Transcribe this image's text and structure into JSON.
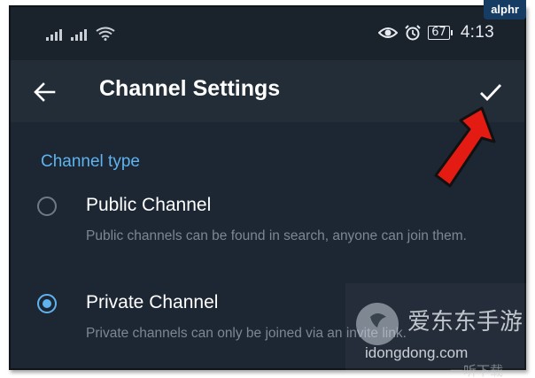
{
  "statusbar": {
    "battery": "67",
    "time": "4:13"
  },
  "toolbar": {
    "title": "Channel Settings"
  },
  "section": {
    "header": "Channel type"
  },
  "options": [
    {
      "label": "Public Channel",
      "description": "Public channels can be found in search, anyone can join them.",
      "selected": false
    },
    {
      "label": "Private Channel",
      "description": "Private channels can only be joined via an invite link.",
      "selected": true
    }
  ],
  "watermark": {
    "site_name": "爱东东手游",
    "domain": "idongdong.com",
    "tagline": "一听下载"
  },
  "logo": {
    "text": "alphr"
  },
  "colors": {
    "accent": "#5fb3ee",
    "background": "#1d2733",
    "toolbar": "#222d38",
    "arrow": "#e31b12"
  }
}
